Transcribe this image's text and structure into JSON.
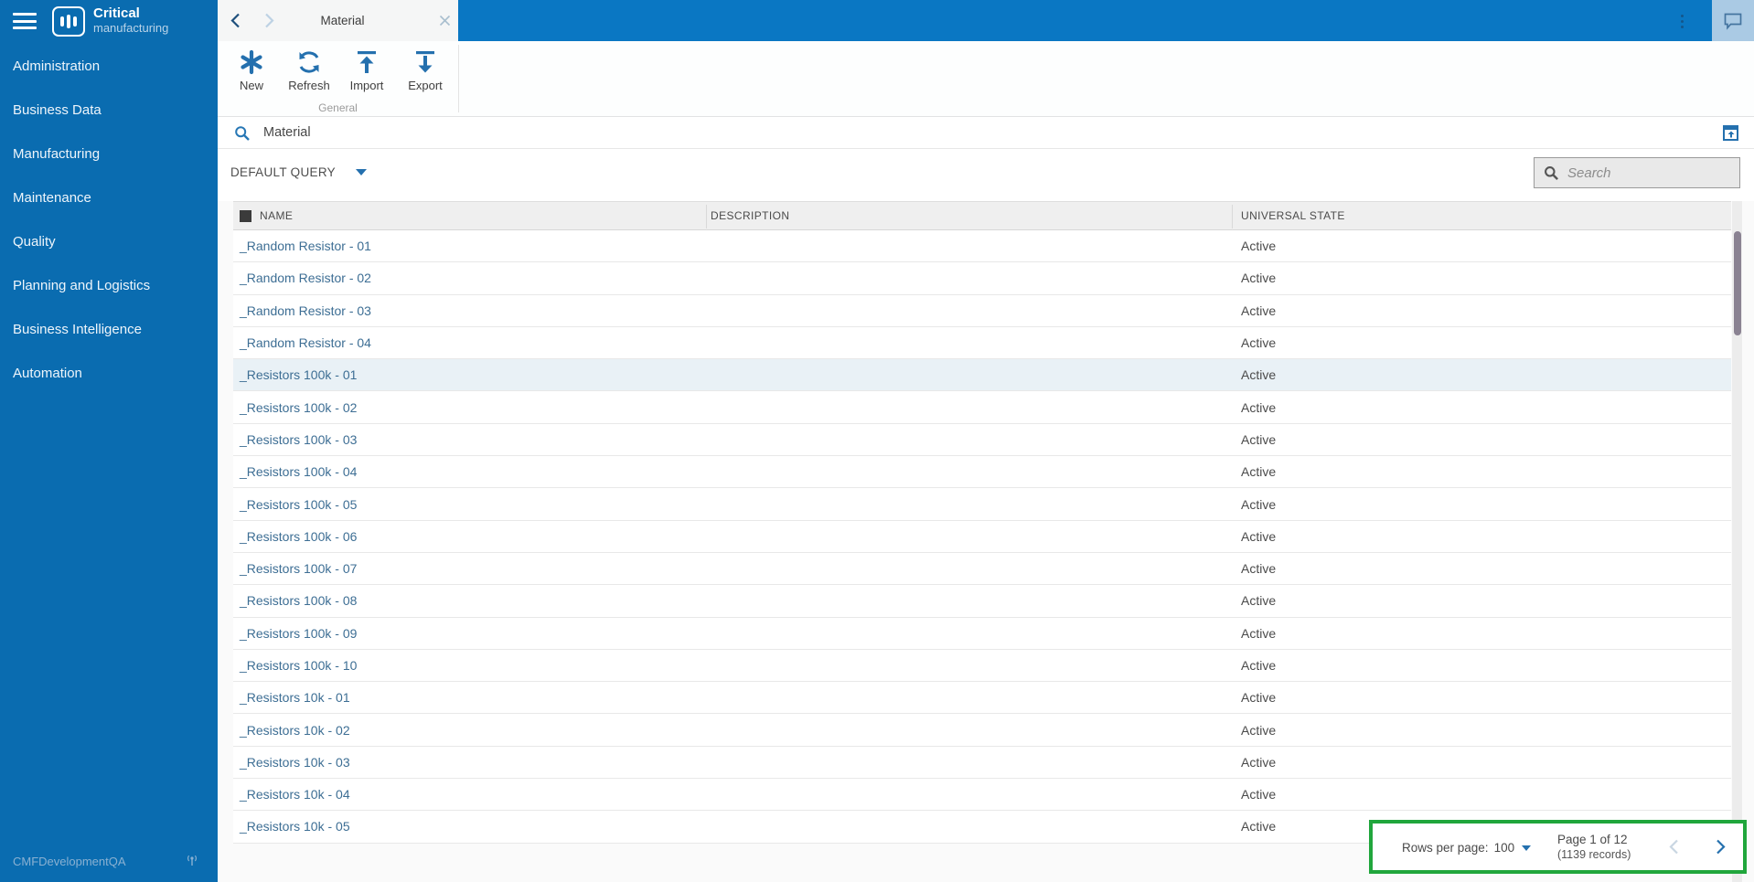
{
  "sidebar": {
    "brand": {
      "name_bold": "Critical",
      "name_light": "manufacturing"
    },
    "items": [
      {
        "label": "Administration"
      },
      {
        "label": "Business Data"
      },
      {
        "label": "Manufacturing"
      },
      {
        "label": "Maintenance"
      },
      {
        "label": "Quality"
      },
      {
        "label": "Planning and Logistics"
      },
      {
        "label": "Business Intelligence"
      },
      {
        "label": "Automation"
      }
    ],
    "footer": {
      "environment": "CMFDevelopmentQA"
    }
  },
  "tabbar": {
    "active_tab": "Material"
  },
  "ribbon": {
    "buttons": [
      {
        "label": "New",
        "icon": "new-asterisk-icon"
      },
      {
        "label": "Refresh",
        "icon": "refresh-icon"
      },
      {
        "label": "Import",
        "icon": "import-icon"
      },
      {
        "label": "Export",
        "icon": "export-icon"
      }
    ],
    "group_label": "General"
  },
  "entity_header": {
    "title": "Material"
  },
  "query_bar": {
    "query_label": "DEFAULT QUERY",
    "search_placeholder": "Search"
  },
  "table": {
    "columns": [
      "NAME",
      "DESCRIPTION",
      "UNIVERSAL STATE"
    ],
    "selected_row_index": 4,
    "rows": [
      {
        "name": "_Random Resistor - 01",
        "description": "",
        "state": "Active"
      },
      {
        "name": "_Random Resistor - 02",
        "description": "",
        "state": "Active"
      },
      {
        "name": "_Random Resistor - 03",
        "description": "",
        "state": "Active"
      },
      {
        "name": "_Random Resistor - 04",
        "description": "",
        "state": "Active"
      },
      {
        "name": "_Resistors 100k - 01",
        "description": "",
        "state": "Active"
      },
      {
        "name": "_Resistors 100k - 02",
        "description": "",
        "state": "Active"
      },
      {
        "name": "_Resistors 100k - 03",
        "description": "",
        "state": "Active"
      },
      {
        "name": "_Resistors 100k - 04",
        "description": "",
        "state": "Active"
      },
      {
        "name": "_Resistors 100k - 05",
        "description": "",
        "state": "Active"
      },
      {
        "name": "_Resistors 100k - 06",
        "description": "",
        "state": "Active"
      },
      {
        "name": "_Resistors 100k - 07",
        "description": "",
        "state": "Active"
      },
      {
        "name": "_Resistors 100k - 08",
        "description": "",
        "state": "Active"
      },
      {
        "name": "_Resistors 100k - 09",
        "description": "",
        "state": "Active"
      },
      {
        "name": "_Resistors 100k - 10",
        "description": "",
        "state": "Active"
      },
      {
        "name": "_Resistors 10k - 01",
        "description": "",
        "state": "Active"
      },
      {
        "name": "_Resistors 10k - 02",
        "description": "",
        "state": "Active"
      },
      {
        "name": "_Resistors 10k - 03",
        "description": "",
        "state": "Active"
      },
      {
        "name": "_Resistors 10k - 04",
        "description": "",
        "state": "Active"
      },
      {
        "name": "_Resistors 10k - 05",
        "description": "",
        "state": "Active"
      }
    ]
  },
  "pagination": {
    "rows_per_page_label": "Rows per page:",
    "rows_per_page_value": "100",
    "page_label": "Page 1 of 12",
    "records_label": "(1139 records)"
  },
  "colors": {
    "sidebar_blue": "#0a6cb0",
    "header_blue": "#0a77c3",
    "accent_blue": "#2470ae",
    "row_link_blue": "#3d6e94",
    "selected_row": "#e9f1f6",
    "annotation_highlight_green": "#20a63c"
  }
}
